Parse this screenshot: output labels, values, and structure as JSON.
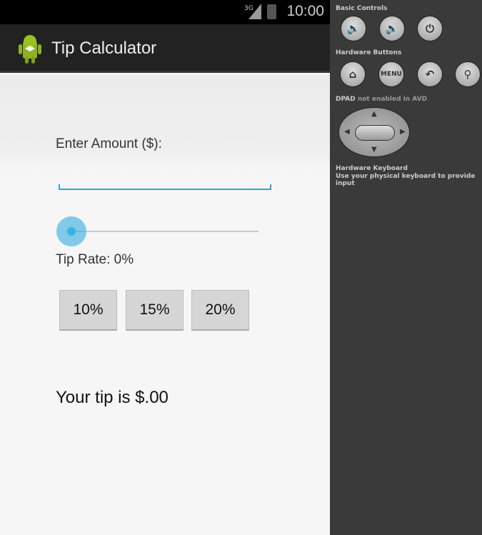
{
  "status_bar": {
    "network": "3G",
    "time": "10:00"
  },
  "action_bar": {
    "title": "Tip Calculator",
    "icon": "android-icon"
  },
  "form": {
    "amount_label": "Enter Amount ($):",
    "amount_value": "",
    "tip_rate_label": "Tip Rate: 0%",
    "tip_rate_percent": 0,
    "buttons": [
      "10%",
      "15%",
      "20%"
    ],
    "result": "Your tip is $.00"
  },
  "emulator": {
    "basic_controls": "Basic Controls",
    "hardware_buttons": "Hardware Buttons",
    "menu_label": "MENU",
    "dpad_title": "DPAD",
    "dpad_note": "not enabled in AVD",
    "keyboard_title": "Hardware Keyboard",
    "keyboard_note": "Use your physical keyboard to provide input"
  },
  "colors": {
    "accent": "#33b5e5",
    "actionbar": "#222222"
  }
}
